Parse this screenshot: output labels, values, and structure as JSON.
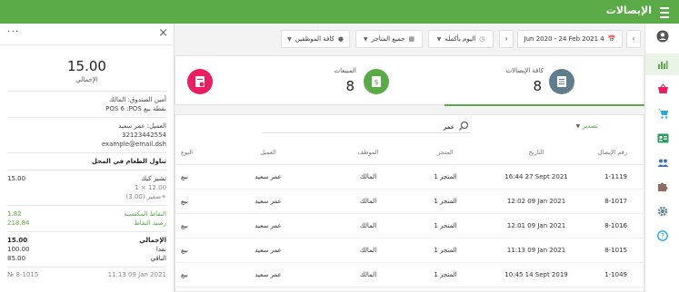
{
  "header": {
    "title": "الإيصالات"
  },
  "toolbar": {
    "date_range": "Jun 2020 - 24 Feb 2021 4",
    "time_filter": "اليوم بأكمله",
    "store_filter": "جميع المتاجر",
    "employee_filter": "كافة الموظفين"
  },
  "cards": [
    {
      "title": "كافة الإيصالات",
      "value": "8",
      "color": "#607d8b"
    },
    {
      "title": "المبيعات",
      "value": "8",
      "color": "#5aaa47"
    },
    {
      "title": "",
      "value": "",
      "color": "#e91e63"
    }
  ],
  "table": {
    "export_label": "تصدير",
    "search_placeholder": "عمر",
    "columns": [
      "رقم الإيصال",
      "التاريخ",
      "المتجر",
      "الموظف",
      "العميل",
      "النوع"
    ],
    "rows": [
      {
        "id": "1-1119",
        "date": "16:44 27 Sept 2021",
        "store": "المتجر 1",
        "employee": "المالك",
        "customer": "عمر سعيد",
        "type": "بيع"
      },
      {
        "id": "8-1017",
        "date": "12:02 09 Jan 2021",
        "store": "المتجر 1",
        "employee": "المالك",
        "customer": "عمر سعيد",
        "type": "بيع"
      },
      {
        "id": "8-1016",
        "date": "12:01 09 Jan 2021",
        "store": "المتجر 1",
        "employee": "المالك",
        "customer": "عمر سعيد",
        "type": "بيع"
      },
      {
        "id": "8-1015",
        "date": "11:13 09 Jan 2021",
        "store": "المتجر 1",
        "employee": "المالك",
        "customer": "عمر سعيد",
        "type": "بيع"
      },
      {
        "id": "1-1049",
        "date": "10:45 14 Sept 2019",
        "store": "المتجر 1",
        "employee": "المالك",
        "customer": "عمر سعيد",
        "type": "بيع"
      }
    ]
  },
  "receipt": {
    "total_value": "15.00",
    "total_label": "الإجمالي",
    "cashier": "أمين الصندوق: المالك",
    "pos": "نقطة بيع POS 6 :POS",
    "customer": "العميل: عمر سعيد",
    "phone": "32123442554",
    "email": "example@email.dsh",
    "dining": "تناول الطعام في المحل",
    "item_name": "تشيز كيك",
    "item_price": "15.00",
    "item_qty": "1 × 12.00",
    "item_modifier": "+صغير (3.00)",
    "points_earned_label": "النقاط المكتسبة",
    "points_earned_value": "1.82",
    "points_balance_label": "رصيد النقاط",
    "points_balance_value": "218.84",
    "total_row_label": "الإجمالي",
    "total_row_value": "15.00",
    "cash_label": "نقدا",
    "cash_value": "100.00",
    "change_label": "الباقي",
    "change_value": "85.00",
    "receipt_no": "№ 8-1015",
    "receipt_date": "11:13 09 Jan 2021"
  }
}
